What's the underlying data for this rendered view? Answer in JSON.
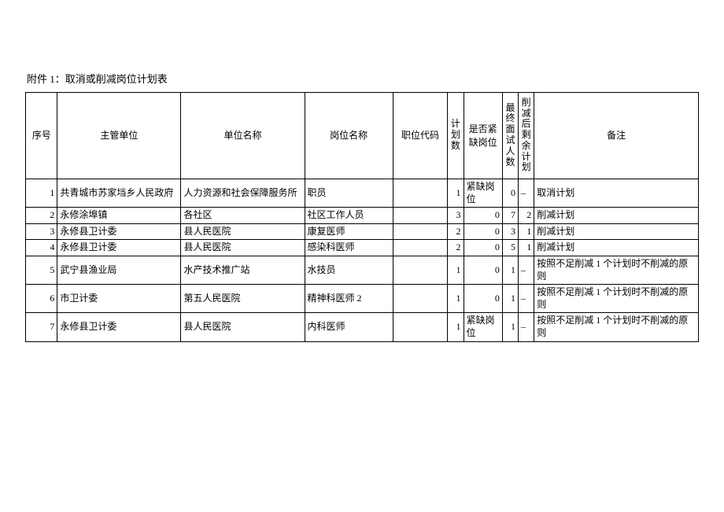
{
  "title": "附件 1：取消或削减岗位计划表",
  "headers": {
    "idx": "序号",
    "dept": "主管单位",
    "unit": "单位名称",
    "post": "岗位名称",
    "code": "职位代码",
    "plan": "计划数",
    "short": "是否紧缺岗位",
    "interv": "最终面试人数",
    "remain": "削减后剩余计划",
    "remark": "备注"
  },
  "rows": [
    {
      "idx": "1",
      "dept": "共青城市苏家垱乡人民政府",
      "unit": "人力资源和社会保障服务所",
      "post": "职员",
      "code": "",
      "plan": "1",
      "short": "紧缺岗位",
      "interv": "0",
      "remain": "–",
      "remark": "取消计划"
    },
    {
      "idx": "2",
      "dept": "永修涂埠镇",
      "unit": "各社区",
      "post": "社区工作人员",
      "code": "",
      "plan": "3",
      "short": "0",
      "interv": "7",
      "remain": "2",
      "remark": "削减计划"
    },
    {
      "idx": "3",
      "dept": "永修县卫计委",
      "unit": "县人民医院",
      "post": "康复医师",
      "code": "",
      "plan": "2",
      "short": "0",
      "interv": "3",
      "remain": "1",
      "remark": "削减计划"
    },
    {
      "idx": "4",
      "dept": "永修县卫计委",
      "unit": "县人民医院",
      "post": "感染科医师",
      "code": "",
      "plan": "2",
      "short": "0",
      "interv": "5",
      "remain": "1",
      "remark": "削减计划"
    },
    {
      "idx": "5",
      "dept": "武宁县渔业局",
      "unit": "水产技术推广站",
      "post": "水技员",
      "code": "",
      "plan": "1",
      "short": "0",
      "interv": "1",
      "remain": "–",
      "remark": "按照不足削减 1 个计划时不削减的原则"
    },
    {
      "idx": "6",
      "dept": "市卫计委",
      "unit": "第五人民医院",
      "post": "精神科医师 2",
      "code": "",
      "plan": "1",
      "short": "0",
      "interv": "1",
      "remain": "–",
      "remark": "按照不足削减 1 个计划时不削减的原则"
    },
    {
      "idx": "7",
      "dept": "永修县卫计委",
      "unit": "县人民医院",
      "post": "内科医师",
      "code": "",
      "plan": "1",
      "short": "紧缺岗位",
      "interv": "1",
      "remain": "–",
      "remark": "按照不足削减 1 个计划时不削减的原则"
    }
  ],
  "chart_data": {
    "type": "table",
    "title": "附件 1：取消或削减岗位计划表",
    "columns": [
      "序号",
      "主管单位",
      "单位名称",
      "岗位名称",
      "职位代码",
      "计划数",
      "是否紧缺岗位",
      "最终面试人数",
      "削减后剩余计划",
      "备注"
    ],
    "rows": [
      [
        "1",
        "共青城市苏家垱乡人民政府",
        "人力资源和社会保障服务所",
        "职员",
        "",
        "1",
        "紧缺岗位",
        "0",
        "–",
        "取消计划"
      ],
      [
        "2",
        "永修涂埠镇",
        "各社区",
        "社区工作人员",
        "",
        "3",
        "0",
        "7",
        "2",
        "削减计划"
      ],
      [
        "3",
        "永修县卫计委",
        "县人民医院",
        "康复医师",
        "",
        "2",
        "0",
        "3",
        "1",
        "削减计划"
      ],
      [
        "4",
        "永修县卫计委",
        "县人民医院",
        "感染科医师",
        "",
        "2",
        "0",
        "5",
        "1",
        "削减计划"
      ],
      [
        "5",
        "武宁县渔业局",
        "水产技术推广站",
        "水技员",
        "",
        "1",
        "0",
        "1",
        "–",
        "按照不足削减 1 个计划时不削减的原则"
      ],
      [
        "6",
        "市卫计委",
        "第五人民医院",
        "精神科医师 2",
        "",
        "1",
        "0",
        "1",
        "–",
        "按照不足削减 1 个计划时不削减的原则"
      ],
      [
        "7",
        "永修县卫计委",
        "县人民医院",
        "内科医师",
        "",
        "1",
        "紧缺岗位",
        "1",
        "–",
        "按照不足削减 1 个计划时不削减的原则"
      ]
    ]
  }
}
